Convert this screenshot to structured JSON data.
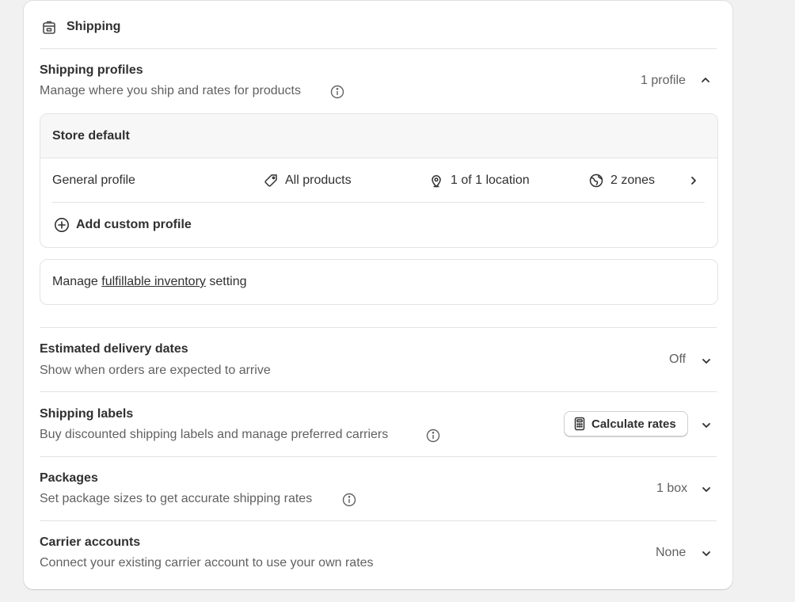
{
  "header": {
    "title": "Shipping",
    "icon": "shipping-box-icon"
  },
  "profiles": {
    "title": "Shipping profiles",
    "subtitle": "Manage where you ship and rates for products",
    "count": "1 profile",
    "store_default": "Store default",
    "general": {
      "name": "General profile",
      "products": "All products",
      "locations": "1 of 1 location",
      "zones": "2 zones"
    },
    "add_custom": "Add custom profile"
  },
  "inventory": {
    "prefix": "Manage",
    "link": "fulfillable inventory",
    "suffix": "setting"
  },
  "sections": [
    {
      "title": "Estimated delivery dates",
      "subtitle": "Show when orders are expected to arrive",
      "value": "Off"
    },
    {
      "title": "Shipping labels",
      "subtitle": "Buy discounted shipping labels and manage preferred carriers",
      "button": "Calculate rates"
    },
    {
      "title": "Packages",
      "subtitle": "Set package sizes to get accurate shipping rates",
      "value": "1 box"
    },
    {
      "title": "Carrier accounts",
      "subtitle": "Connect your existing carrier account to use your own rates",
      "value": "None"
    }
  ],
  "colors": {
    "background": "#f1f1f1",
    "card": "#ffffff",
    "text": "#303030",
    "muted": "#616161",
    "border": "#e3e3e3"
  }
}
